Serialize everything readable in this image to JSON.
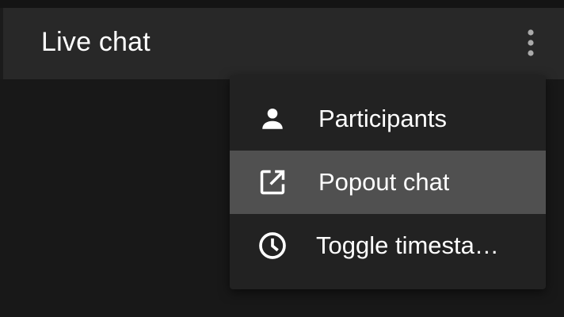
{
  "header": {
    "title": "Live chat",
    "more_icon": "more-vert-icon"
  },
  "menu": {
    "items": [
      {
        "label": "Participants",
        "icon": "person-icon",
        "highlighted": false
      },
      {
        "label": "Popout chat",
        "icon": "open-in-new-icon",
        "highlighted": true
      },
      {
        "label": "Toggle timesta…",
        "icon": "clock-icon",
        "highlighted": false
      }
    ]
  },
  "colors": {
    "header_bg": "#282828",
    "menu_bg": "#222222",
    "highlight_bg": "#505050",
    "text": "#ffffff",
    "more_icon": "#aaaaaa"
  }
}
